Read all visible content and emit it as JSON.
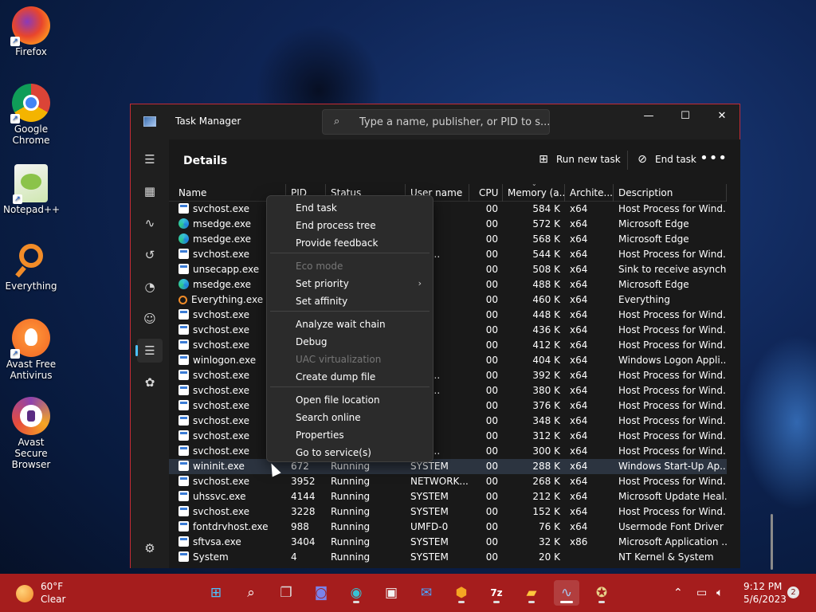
{
  "desktop": {
    "icons": [
      {
        "label": "Firefox"
      },
      {
        "label": "Google Chrome"
      },
      {
        "label": "Notepad++"
      },
      {
        "label": "Everything"
      },
      {
        "label": "Avast Free Antivirus"
      },
      {
        "label": "Avast Secure Browser"
      }
    ]
  },
  "window": {
    "title": "Task Manager",
    "search_placeholder": "Type a name, publisher, or PID to s...",
    "minimize": "—",
    "maximize": "☐",
    "close": "✕"
  },
  "sidebar": {
    "hamburger": "☰",
    "items": [
      {
        "icon": "processes-icon",
        "glyph": "▦"
      },
      {
        "icon": "performance-icon",
        "glyph": "∿"
      },
      {
        "icon": "app-history-icon",
        "glyph": "↺"
      },
      {
        "icon": "startup-apps-icon",
        "glyph": "◔"
      },
      {
        "icon": "users-icon",
        "glyph": "☺"
      },
      {
        "icon": "details-icon",
        "glyph": "☰"
      },
      {
        "icon": "services-icon",
        "glyph": "✿"
      }
    ],
    "settings_glyph": "⚙"
  },
  "header": {
    "title": "Details",
    "run_new_task": "Run new task",
    "end_task": "End task",
    "more": "•••"
  },
  "table": {
    "columns": [
      "Name",
      "PID",
      "Status",
      "User name",
      "CPU",
      "Memory (a...",
      "Archite...",
      "Description"
    ],
    "rows": [
      {
        "icon": "svc",
        "name": "svchost.exe",
        "pid": "",
        "status": "",
        "user": "M",
        "cpu": "00",
        "mem": "584 K",
        "arch": "x64",
        "desc": "Host Process for Wind..."
      },
      {
        "icon": "edge",
        "name": "msedge.exe",
        "pid": "",
        "status": "",
        "user": "",
        "cpu": "00",
        "mem": "572 K",
        "arch": "x64",
        "desc": "Microsoft Edge"
      },
      {
        "icon": "edge",
        "name": "msedge.exe",
        "pid": "",
        "status": "",
        "user": "",
        "cpu": "00",
        "mem": "568 K",
        "arch": "x64",
        "desc": "Microsoft Edge"
      },
      {
        "icon": "svc",
        "name": "svchost.exe",
        "pid": "",
        "status": "",
        "user": "L SE...",
        "cpu": "00",
        "mem": "544 K",
        "arch": "x64",
        "desc": "Host Process for Wind..."
      },
      {
        "icon": "svc",
        "name": "unsecapp.exe",
        "pid": "",
        "status": "",
        "user": "M",
        "cpu": "00",
        "mem": "508 K",
        "arch": "x64",
        "desc": "Sink to receive asynch..."
      },
      {
        "icon": "edge",
        "name": "msedge.exe",
        "pid": "",
        "status": "",
        "user": "",
        "cpu": "00",
        "mem": "488 K",
        "arch": "x64",
        "desc": "Microsoft Edge"
      },
      {
        "icon": "evr",
        "name": "Everything.exe",
        "pid": "",
        "status": "",
        "user": "M",
        "cpu": "00",
        "mem": "460 K",
        "arch": "x64",
        "desc": "Everything"
      },
      {
        "icon": "svc",
        "name": "svchost.exe",
        "pid": "",
        "status": "",
        "user": "",
        "cpu": "00",
        "mem": "448 K",
        "arch": "x64",
        "desc": "Host Process for Wind..."
      },
      {
        "icon": "svc",
        "name": "svchost.exe",
        "pid": "",
        "status": "",
        "user": "M",
        "cpu": "00",
        "mem": "436 K",
        "arch": "x64",
        "desc": "Host Process for Wind..."
      },
      {
        "icon": "svc",
        "name": "svchost.exe",
        "pid": "",
        "status": "",
        "user": "M",
        "cpu": "00",
        "mem": "412 K",
        "arch": "x64",
        "desc": "Host Process for Wind..."
      },
      {
        "icon": "svc",
        "name": "winlogon.exe",
        "pid": "",
        "status": "",
        "user": "M",
        "cpu": "00",
        "mem": "404 K",
        "arch": "x64",
        "desc": "Windows Logon Appli..."
      },
      {
        "icon": "svc",
        "name": "svchost.exe",
        "pid": "",
        "status": "",
        "user": "L SE...",
        "cpu": "00",
        "mem": "392 K",
        "arch": "x64",
        "desc": "Host Process for Wind..."
      },
      {
        "icon": "svc",
        "name": "svchost.exe",
        "pid": "",
        "status": "",
        "user": "L SE...",
        "cpu": "00",
        "mem": "380 K",
        "arch": "x64",
        "desc": "Host Process for Wind..."
      },
      {
        "icon": "svc",
        "name": "svchost.exe",
        "pid": "",
        "status": "",
        "user": "M",
        "cpu": "00",
        "mem": "376 K",
        "arch": "x64",
        "desc": "Host Process for Wind..."
      },
      {
        "icon": "svc",
        "name": "svchost.exe",
        "pid": "",
        "status": "",
        "user": "M",
        "cpu": "00",
        "mem": "348 K",
        "arch": "x64",
        "desc": "Host Process for Wind..."
      },
      {
        "icon": "svc",
        "name": "svchost.exe",
        "pid": "",
        "status": "",
        "user": "M",
        "cpu": "00",
        "mem": "312 K",
        "arch": "x64",
        "desc": "Host Process for Wind..."
      },
      {
        "icon": "svc",
        "name": "svchost.exe",
        "pid": "",
        "status": "",
        "user": "L SE...",
        "cpu": "00",
        "mem": "300 K",
        "arch": "x64",
        "desc": "Host Process for Wind..."
      },
      {
        "icon": "svc",
        "name": "wininit.exe",
        "pid": "672",
        "status": "Running",
        "user": "SYSTEM",
        "cpu": "00",
        "mem": "288 K",
        "arch": "x64",
        "desc": "Windows Start-Up Ap...",
        "selected": true
      },
      {
        "icon": "svc",
        "name": "svchost.exe",
        "pid": "3952",
        "status": "Running",
        "user": "NETWORK...",
        "cpu": "00",
        "mem": "268 K",
        "arch": "x64",
        "desc": "Host Process for Wind..."
      },
      {
        "icon": "svc",
        "name": "uhssvc.exe",
        "pid": "4144",
        "status": "Running",
        "user": "SYSTEM",
        "cpu": "00",
        "mem": "212 K",
        "arch": "x64",
        "desc": "Microsoft Update Heal..."
      },
      {
        "icon": "svc",
        "name": "svchost.exe",
        "pid": "3228",
        "status": "Running",
        "user": "SYSTEM",
        "cpu": "00",
        "mem": "152 K",
        "arch": "x64",
        "desc": "Host Process for Wind..."
      },
      {
        "icon": "svc",
        "name": "fontdrvhost.exe",
        "pid": "988",
        "status": "Running",
        "user": "UMFD-0",
        "cpu": "00",
        "mem": "76 K",
        "arch": "x64",
        "desc": "Usermode Font Driver ..."
      },
      {
        "icon": "svc",
        "name": "sftvsa.exe",
        "pid": "3404",
        "status": "Running",
        "user": "SYSTEM",
        "cpu": "00",
        "mem": "32 K",
        "arch": "x86",
        "desc": "Microsoft Application ..."
      },
      {
        "icon": "svc",
        "name": "System",
        "pid": "4",
        "status": "Running",
        "user": "SYSTEM",
        "cpu": "00",
        "mem": "20 K",
        "arch": "",
        "desc": "NT Kernel & System"
      }
    ]
  },
  "context_menu": {
    "items": [
      {
        "label": "End task",
        "disabled": false
      },
      {
        "label": "End process tree",
        "disabled": false
      },
      {
        "label": "Provide feedback",
        "disabled": false
      },
      {
        "label": "Eco mode",
        "disabled": true
      },
      {
        "label": "Set priority",
        "disabled": false,
        "submenu": true
      },
      {
        "label": "Set affinity",
        "disabled": false
      },
      {
        "label": "Analyze wait chain",
        "disabled": false
      },
      {
        "label": "Debug",
        "disabled": false
      },
      {
        "label": "UAC virtualization",
        "disabled": true
      },
      {
        "label": "Create dump file",
        "disabled": false
      },
      {
        "label": "Open file location",
        "disabled": false
      },
      {
        "label": "Search online",
        "disabled": false
      },
      {
        "label": "Properties",
        "disabled": false
      },
      {
        "label": "Go to service(s)",
        "disabled": false
      }
    ]
  },
  "taskbar": {
    "weather_temp": "60°F",
    "weather_cond": "Clear",
    "clock_time": "9:12 PM",
    "clock_date": "5/6/2023",
    "notification_count": "2",
    "apps": [
      {
        "name": "start-icon",
        "glyph": "⊞",
        "color": "#4cc2ff"
      },
      {
        "name": "search-icon",
        "glyph": "⌕",
        "color": "#ffffff"
      },
      {
        "name": "task-view-icon",
        "glyph": "❐",
        "color": "#dddddd"
      },
      {
        "name": "teams-chat-icon",
        "glyph": "◙",
        "color": "#7b83eb"
      },
      {
        "name": "edge-icon",
        "glyph": "◉",
        "color": "#38c1d4"
      },
      {
        "name": "store-icon",
        "glyph": "▣",
        "color": "#f3f3f3"
      },
      {
        "name": "mail-icon",
        "glyph": "✉",
        "color": "#4aa3ff"
      },
      {
        "name": "avast-browser-icon",
        "glyph": "⬢",
        "color": "#f5a623"
      },
      {
        "name": "7zip-icon",
        "glyph": "7z",
        "color": "#ffffff"
      },
      {
        "name": "file-explorer-icon",
        "glyph": "▰",
        "color": "#ffc83d"
      },
      {
        "name": "task-manager-icon",
        "glyph": "∿",
        "color": "#a9c8f0"
      },
      {
        "name": "app-icon",
        "glyph": "✪",
        "color": "#e8d48a"
      }
    ]
  }
}
